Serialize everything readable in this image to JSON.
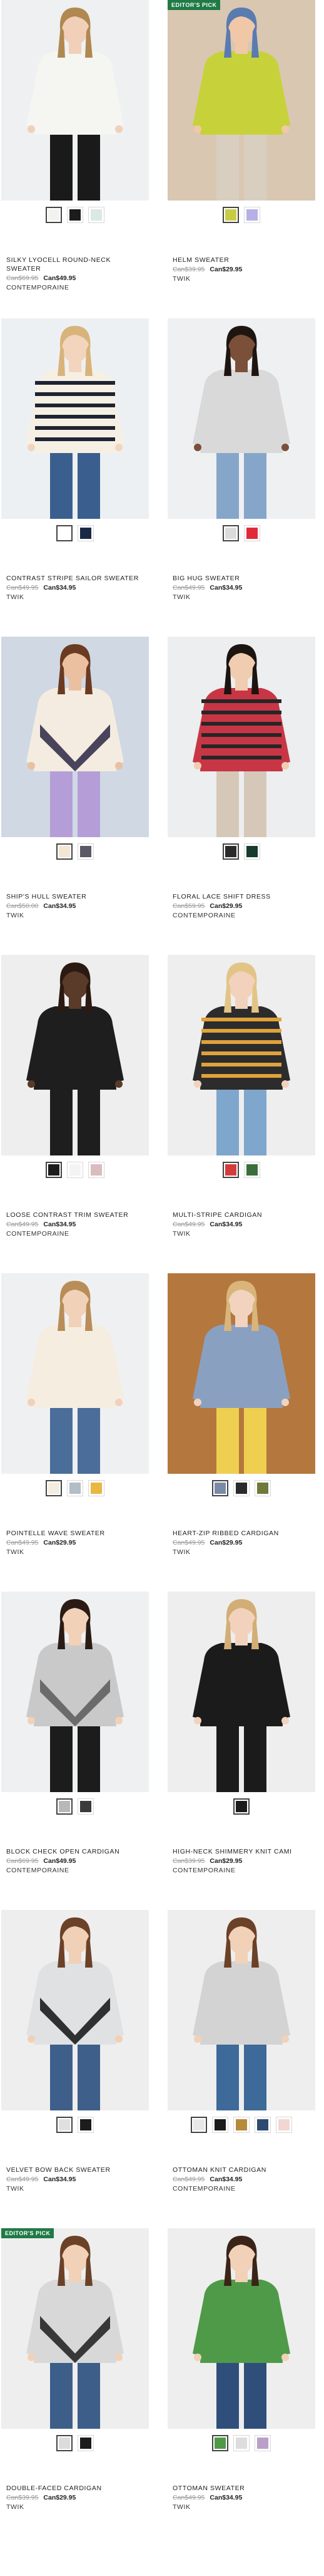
{
  "badge_label": "EDITOR'S PICK",
  "products": [
    {
      "name": "SILKY LYOCELL ROUND-NECK SWEATER",
      "old_price": "Can$69.95",
      "price": "Can$49.95",
      "brand": "CONTEMPORAINE",
      "badge": false,
      "swatches": [
        "#f2f2ee",
        "#1c1c1c",
        "#dbe9e2"
      ],
      "selected": 0,
      "scene": {
        "bg": "#eef0f1",
        "top": "#f5f5f2",
        "bottom": "#1a1a1a",
        "skin": "#f1cfb8",
        "hair": "#b08850"
      }
    },
    {
      "name": "HELM SWEATER",
      "old_price": "Can$39.95",
      "price": "Can$29.95",
      "brand": "TWIK",
      "badge": true,
      "swatches": [
        "#c8cc44",
        "#b6b0e6"
      ],
      "selected": 0,
      "scene": {
        "bg": "#d9c7b1",
        "top": "#c7d23a",
        "bottom": "#d8cfc0",
        "skin": "#f0c8a8",
        "hair": "#5a7bb0"
      }
    },
    {
      "name": "CONTRAST STRIPE SAILOR SWEATER",
      "old_price": "Can$49.95",
      "price": "Can$34.95",
      "brand": "TWIK",
      "badge": false,
      "swatches": [
        "#ffffff",
        "#1b2a44"
      ],
      "selected": 0,
      "scene": {
        "bg": "#edf0f2",
        "top": "#f6f0e4",
        "bottom": "#3a5f8f",
        "skin": "#f3d4bd",
        "hair": "#d8b37a",
        "stripes": "#1f2333"
      }
    },
    {
      "name": "BIG HUG SWEATER",
      "old_price": "Can$49.95",
      "price": "Can$34.95",
      "brand": "TWIK",
      "badge": false,
      "swatches": [
        "#dcdcdc",
        "#e02a3a"
      ],
      "selected": 0,
      "scene": {
        "bg": "#eff0f2",
        "top": "#d9d9d9",
        "bottom": "#86a6c9",
        "skin": "#7a5038",
        "hair": "#1f1510"
      }
    },
    {
      "name": "SHIP'S HULL SWEATER",
      "old_price": "Can$50.00",
      "price": "Can$34.95",
      "brand": "TWIK",
      "badge": false,
      "swatches": [
        "#f3e6d3",
        "#5a5a66"
      ],
      "selected": 0,
      "scene": {
        "bg": "#cfd8e3",
        "top": "#f4ece0",
        "bottom": "#b59ed8",
        "skin": "#eac0a0",
        "hair": "#6b3a22",
        "accent": "#2a2744"
      }
    },
    {
      "name": "FLORAL LACE SHIFT DRESS",
      "old_price": "Can$59.95",
      "price": "Can$29.95",
      "brand": "CONTEMPORAINE",
      "badge": false,
      "swatches": [
        "#2b2b2b",
        "#173b2c"
      ],
      "selected": 0,
      "scene": {
        "bg": "#eceeef",
        "top": "#c83646",
        "bottom": "#d6c8b8",
        "skin": "#f0cdb0",
        "hair": "#1c1410",
        "stripes": "#262626"
      }
    },
    {
      "name": "LOOSE CONTRAST TRIM SWEATER",
      "old_price": "Can$49.95",
      "price": "Can$34.95",
      "brand": "CONTEMPORAINE",
      "badge": false,
      "swatches": [
        "#1c1c1c",
        "#f4f4f4",
        "#d9bcc0"
      ],
      "selected": 0,
      "scene": {
        "bg": "#eeeeee",
        "top": "#1e1e1e",
        "bottom": "#1e1e1e",
        "skin": "#5a3a28",
        "hair": "#2a1a12"
      }
    },
    {
      "name": "MULTI-STRIPE CARDIGAN",
      "old_price": "Can$49.95",
      "price": "Can$34.95",
      "brand": "TWIK",
      "badge": false,
      "swatches": [
        "#d43b3b",
        "#3a6e3a"
      ],
      "selected": 0,
      "scene": {
        "bg": "#eeeeee",
        "top": "#2c2c2c",
        "bottom": "#7fa6cc",
        "skin": "#f2d2bc",
        "hair": "#e3c487",
        "stripes": "#e0a23a"
      }
    },
    {
      "name": "POINTELLE WAVE SWEATER",
      "old_price": "Can$49.95",
      "price": "Can$29.95",
      "brand": "TWIK",
      "badge": false,
      "swatches": [
        "#f3ece0",
        "#b4bcc6",
        "#e8b844"
      ],
      "selected": 0,
      "scene": {
        "bg": "#eff0f1",
        "top": "#f4ede0",
        "bottom": "#4a6d99",
        "skin": "#f1d1b8",
        "hair": "#b88d58"
      }
    },
    {
      "name": "HEART-ZIP RIBBED CARDIGAN",
      "old_price": "Can$49.95",
      "price": "Can$29.95",
      "brand": "TWIK",
      "badge": false,
      "swatches": [
        "#7c8aa8",
        "#2a2a2a",
        "#6f7a3a"
      ],
      "selected": 0,
      "scene": {
        "bg": "#b4773e",
        "top": "#8aa0c0",
        "bottom": "#efcf50",
        "skin": "#f1d3bf",
        "hair": "#d9b57a"
      }
    },
    {
      "name": "BLOCK CHECK OPEN CARDIGAN",
      "old_price": "Can$69.95",
      "price": "Can$49.95",
      "brand": "CONTEMPORAINE",
      "badge": false,
      "swatches": [
        "#b8b8b8",
        "#3a3a3a"
      ],
      "selected": 0,
      "scene": {
        "bg": "#eff0f1",
        "top": "#c9c9c9",
        "bottom": "#1c1c1c",
        "skin": "#f1d1b8",
        "hair": "#2a1c14",
        "accent": "#5a5a5a"
      }
    },
    {
      "name": "HIGH-NECK SHIMMERY KNIT CAMI",
      "old_price": "Can$39.95",
      "price": "Can$29.95",
      "brand": "CONTEMPORAINE",
      "badge": false,
      "swatches": [
        "#1c1c1c"
      ],
      "selected": 0,
      "scene": {
        "bg": "#eeeeee",
        "top": "#1b1b1b",
        "bottom": "#1b1b1b",
        "skin": "#f2d2bc",
        "hair": "#d2ae76"
      }
    },
    {
      "name": "VELVET BOW BACK SWEATER",
      "old_price": "Can$49.95",
      "price": "Can$34.95",
      "brand": "TWIK",
      "badge": false,
      "swatches": [
        "#e0e0e0",
        "#1c1c1c"
      ],
      "selected": 0,
      "scene": {
        "bg": "#eeeeee",
        "top": "#dfe1e3",
        "bottom": "#3d5f8a",
        "skin": "#f1d0b8",
        "hair": "#6b4128",
        "accent": "#111111"
      }
    },
    {
      "name": "OTTOMAN KNIT CARDIGAN",
      "old_price": "Can$49.95",
      "price": "Can$34.95",
      "brand": "CONTEMPORAINE",
      "badge": false,
      "swatches": [
        "#e8e8e8",
        "#1c1c1c",
        "#b78a3a",
        "#2e4a70",
        "#f1d6d2"
      ],
      "selected": 0,
      "scene": {
        "bg": "#eeeeee",
        "top": "#d3d3d3",
        "bottom": "#3d6a98",
        "skin": "#f1d1b8",
        "hair": "#6b4128"
      }
    },
    {
      "name": "DOUBLE-FACED CARDIGAN",
      "old_price": "Can$39.95",
      "price": "Can$29.95",
      "brand": "TWIK",
      "badge": true,
      "swatches": [
        "#dcdcdc",
        "#1c1c1c"
      ],
      "selected": 0,
      "scene": {
        "bg": "#eeeeee",
        "top": "#d8d8d8",
        "bottom": "#3c5e89",
        "skin": "#f1d1b8",
        "hair": "#6b4128",
        "accent": "#1c1c1c"
      }
    },
    {
      "name": "OTTOMAN SWEATER",
      "old_price": "Can$49.95",
      "price": "Can$34.95",
      "brand": "TWIK",
      "badge": false,
      "swatches": [
        "#4f9a48",
        "#dddddd",
        "#b9a0c8"
      ],
      "selected": 0,
      "scene": {
        "bg": "#eeeeee",
        "top": "#4f9a48",
        "bottom": "#2f4f7a",
        "skin": "#f1d1b8",
        "hair": "#3a2418"
      }
    }
  ]
}
